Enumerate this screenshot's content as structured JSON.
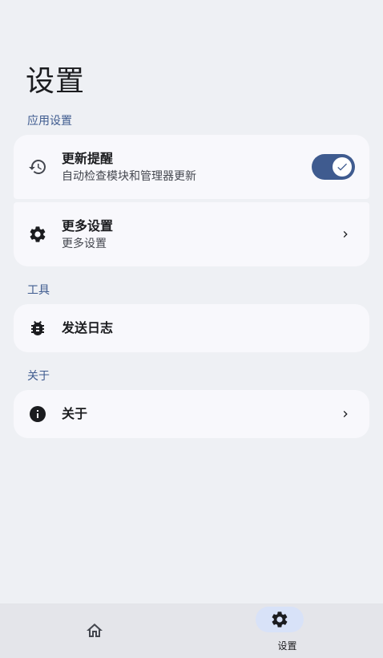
{
  "header": {
    "title": "设置"
  },
  "sections": {
    "app_settings": {
      "label": "应用设置",
      "update_reminder": {
        "title": "更新提醒",
        "subtitle": "自动检查模块和管理器更新",
        "icon": "history-icon",
        "enabled": true
      },
      "more_settings": {
        "title": "更多设置",
        "subtitle": "更多设置",
        "icon": "gear-icon"
      }
    },
    "tools": {
      "label": "工具",
      "send_log": {
        "title": "发送日志",
        "icon": "bug-icon"
      }
    },
    "about": {
      "label": "关于",
      "about": {
        "title": "关于",
        "icon": "info-icon"
      }
    }
  },
  "bottom_nav": {
    "items": [
      {
        "label": "",
        "icon": "home-icon",
        "active": false
      },
      {
        "label": "设置",
        "icon": "gear-icon",
        "active": true
      }
    ]
  },
  "colors": {
    "accent": "#3f5b8f",
    "background": "#eef0f4",
    "card": "#f8f8fc"
  }
}
